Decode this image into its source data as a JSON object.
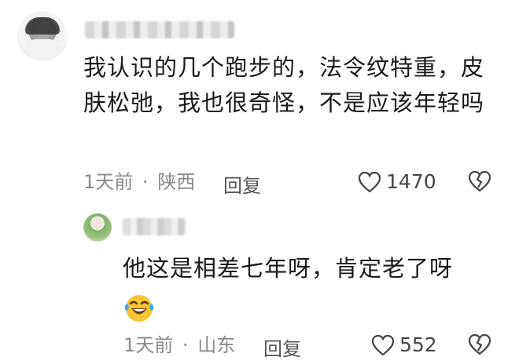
{
  "comment": {
    "text": "我认识的几个跑步的，法令纹特重，皮肤松弛，我也很奇怪，不是应该年轻吗",
    "time": "1天前",
    "separator": "·",
    "location": "陕西",
    "reply_label": "回复",
    "likes": "1470"
  },
  "reply": {
    "text": "他这是相差七年呀，肯定老了呀",
    "emoji_icon": "laughing-crying-face-icon",
    "time": "1天前",
    "separator": "·",
    "location": "山东",
    "reply_label": "回复",
    "likes": "552"
  },
  "colors": {
    "text": "#1a1a1a",
    "meta": "#8a8a8a",
    "emoji_yellow": "#f7c531",
    "emoji_tear": "#3ea6f2"
  }
}
